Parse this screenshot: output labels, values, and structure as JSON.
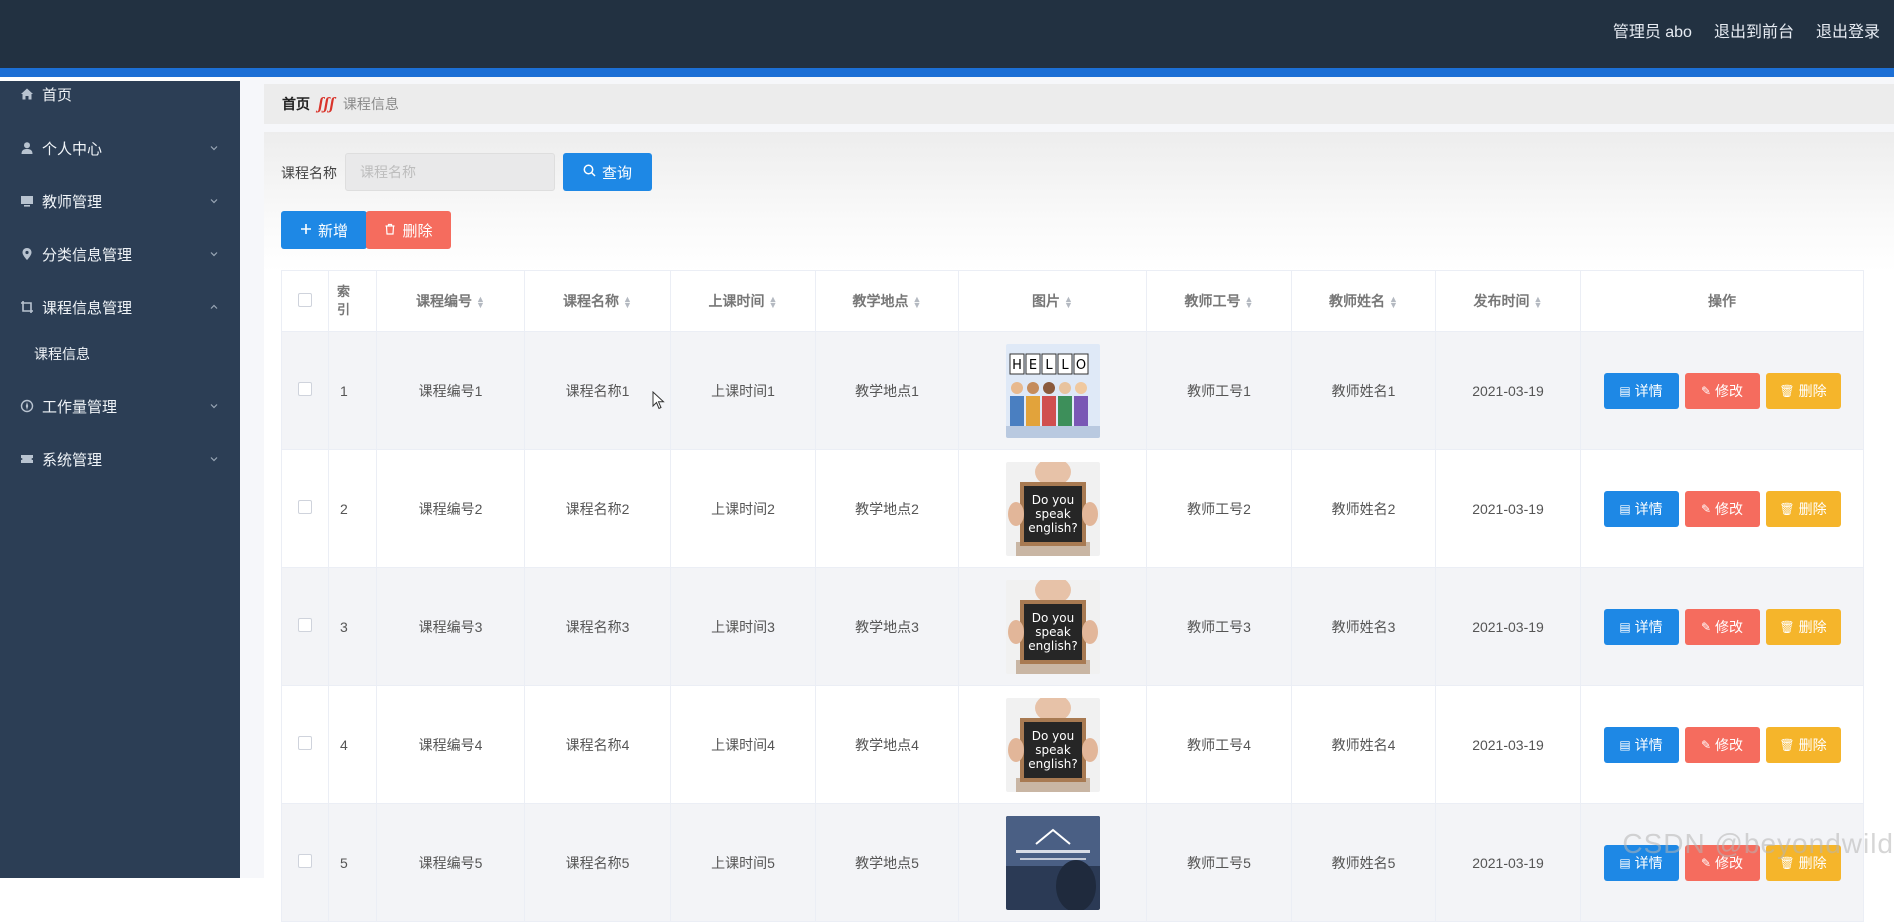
{
  "topbar": {
    "admin_label": "管理员 abo",
    "exit_front": "退出到前台",
    "logout": "退出登录"
  },
  "sidebar": {
    "items": [
      {
        "label": "首页",
        "icon": "home-icon"
      },
      {
        "label": "个人中心",
        "icon": "user-icon"
      },
      {
        "label": "教师管理",
        "icon": "monitor-icon"
      },
      {
        "label": "分类信息管理",
        "icon": "location-pin-icon"
      },
      {
        "label": "课程信息管理",
        "icon": "crop-icon"
      },
      {
        "label": "课程信息",
        "icon": ""
      },
      {
        "label": "工作量管理",
        "icon": "compass-icon"
      },
      {
        "label": "系统管理",
        "icon": "ticket-icon"
      }
    ]
  },
  "breadcrumb": {
    "home": "首页",
    "current": "课程信息"
  },
  "search": {
    "label": "课程名称",
    "placeholder": "课程名称",
    "query_label": "查询"
  },
  "toolbar": {
    "add_label": "新增",
    "delete_label": "删除"
  },
  "table": {
    "headers": {
      "index": "索引",
      "course_no": "课程编号",
      "course_name": "课程名称",
      "class_time": "上课时间",
      "location": "教学地点",
      "image": "图片",
      "teacher_no": "教师工号",
      "teacher_name": "教师姓名",
      "publish_time": "发布时间",
      "actions": "操作"
    },
    "rows": [
      {
        "index": "1",
        "course_no": "课程编号1",
        "course_name": "课程名称1",
        "class_time": "上课时间1",
        "location": "教学地点1",
        "image": "HELLO",
        "teacher_no": "教师工号1",
        "teacher_name": "教师姓名1",
        "publish_time": "2021-03-19"
      },
      {
        "index": "2",
        "course_no": "课程编号2",
        "course_name": "课程名称2",
        "class_time": "上课时间2",
        "location": "教学地点2",
        "image": "Do you speak english?",
        "teacher_no": "教师工号2",
        "teacher_name": "教师姓名2",
        "publish_time": "2021-03-19"
      },
      {
        "index": "3",
        "course_no": "课程编号3",
        "course_name": "课程名称3",
        "class_time": "上课时间3",
        "location": "教学地点3",
        "image": "Do you speak english?",
        "teacher_no": "教师工号3",
        "teacher_name": "教师姓名3",
        "publish_time": "2021-03-19"
      },
      {
        "index": "4",
        "course_no": "课程编号4",
        "course_name": "课程名称4",
        "class_time": "上课时间4",
        "location": "教学地点4",
        "image": "Do you speak english?",
        "teacher_no": "教师工号4",
        "teacher_name": "教师姓名4",
        "publish_time": "2021-03-19"
      },
      {
        "index": "5",
        "course_no": "课程编号5",
        "course_name": "课程名称5",
        "class_time": "上课时间5",
        "location": "教学地点5",
        "image": "",
        "teacher_no": "教师工号5",
        "teacher_name": "教师姓名5",
        "publish_time": "2021-03-19"
      }
    ],
    "actions": {
      "detail": "详情",
      "edit": "修改",
      "delete": "删除"
    }
  },
  "watermark": "CSDN @beyondwild",
  "colors": {
    "topbar": "#223141",
    "accent": "#1c6fd5",
    "sidebar": "#2c3e55",
    "primary": "#1e88e5",
    "danger": "#f56c5e",
    "warning": "#f5b52b"
  }
}
